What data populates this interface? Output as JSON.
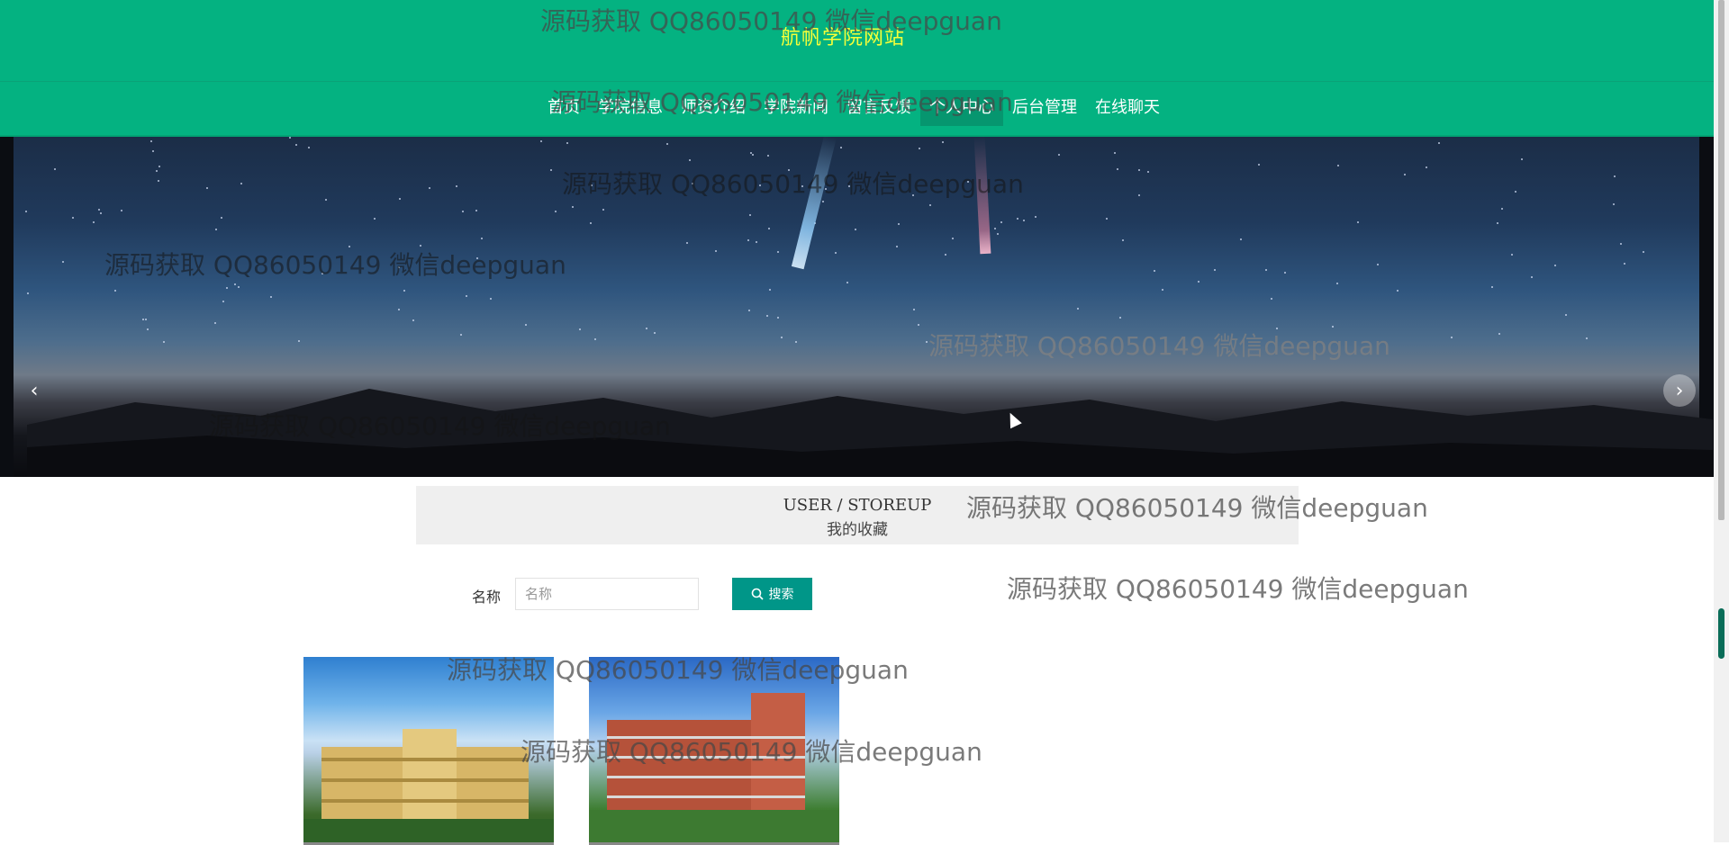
{
  "header": {
    "site_title": "航帆学院网站",
    "nav": [
      {
        "label": "首页"
      },
      {
        "label": "学院信息"
      },
      {
        "label": "师资介绍"
      },
      {
        "label": "学院新闻"
      },
      {
        "label": "留言反馈"
      },
      {
        "label": "个人中心",
        "active": true
      },
      {
        "label": "后台管理"
      },
      {
        "label": "在线聊天"
      }
    ],
    "brand_color": "#04b281",
    "title_color": "#f7ff38"
  },
  "carousel": {
    "prev_icon": "chevron-left-icon",
    "next_icon": "chevron-right-icon"
  },
  "section": {
    "title_en": "USER / STOREUP",
    "title_cn": "我的收藏"
  },
  "search": {
    "label": "名称",
    "placeholder": "名称",
    "value": "",
    "button_label": "搜索",
    "button_icon": "search-icon",
    "button_color": "#009688"
  },
  "watermark": "源码获取 QQ86050149 微信deepguan"
}
